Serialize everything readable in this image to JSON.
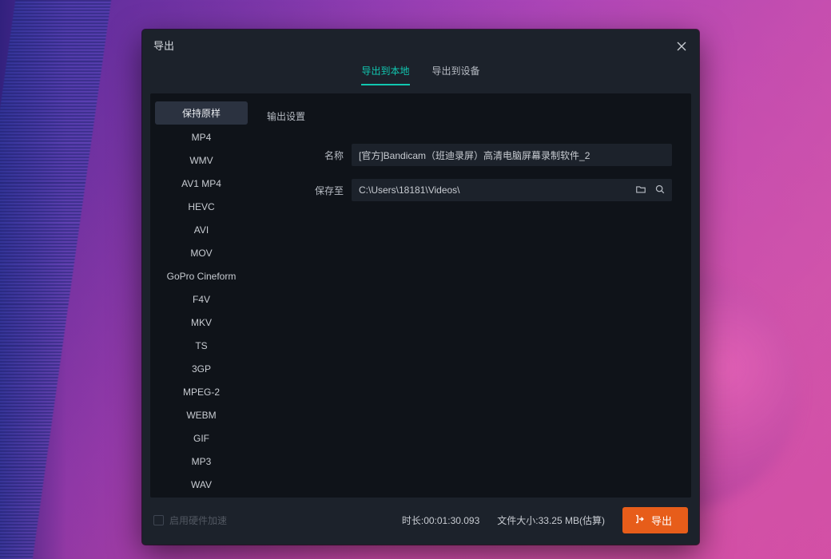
{
  "dialog": {
    "title": "导出",
    "tabs": {
      "local": "导出到本地",
      "device": "导出到设备",
      "active": "local"
    }
  },
  "formats": {
    "items": [
      "保持原样",
      "MP4",
      "WMV",
      "AV1 MP4",
      "HEVC",
      "AVI",
      "MOV",
      "GoPro Cineform",
      "F4V",
      "MKV",
      "TS",
      "3GP",
      "MPEG-2",
      "WEBM",
      "GIF",
      "MP3",
      "WAV"
    ],
    "selected_index": 0
  },
  "settings": {
    "section_title": "输出设置",
    "name_label": "名称",
    "name_value": "[官方]Bandicam（班迪录屏）高清电脑屏幕录制软件_2",
    "save_to_label": "保存至",
    "save_to_value": "C:\\Users\\18181\\Videos\\"
  },
  "footer": {
    "hw_accel_label": "启用硬件加速",
    "duration_label": "时长:",
    "duration_value": "00:01:30.093",
    "filesize_label": "文件大小:",
    "filesize_value": "33.25 MB(估算)",
    "export_label": "导出"
  }
}
